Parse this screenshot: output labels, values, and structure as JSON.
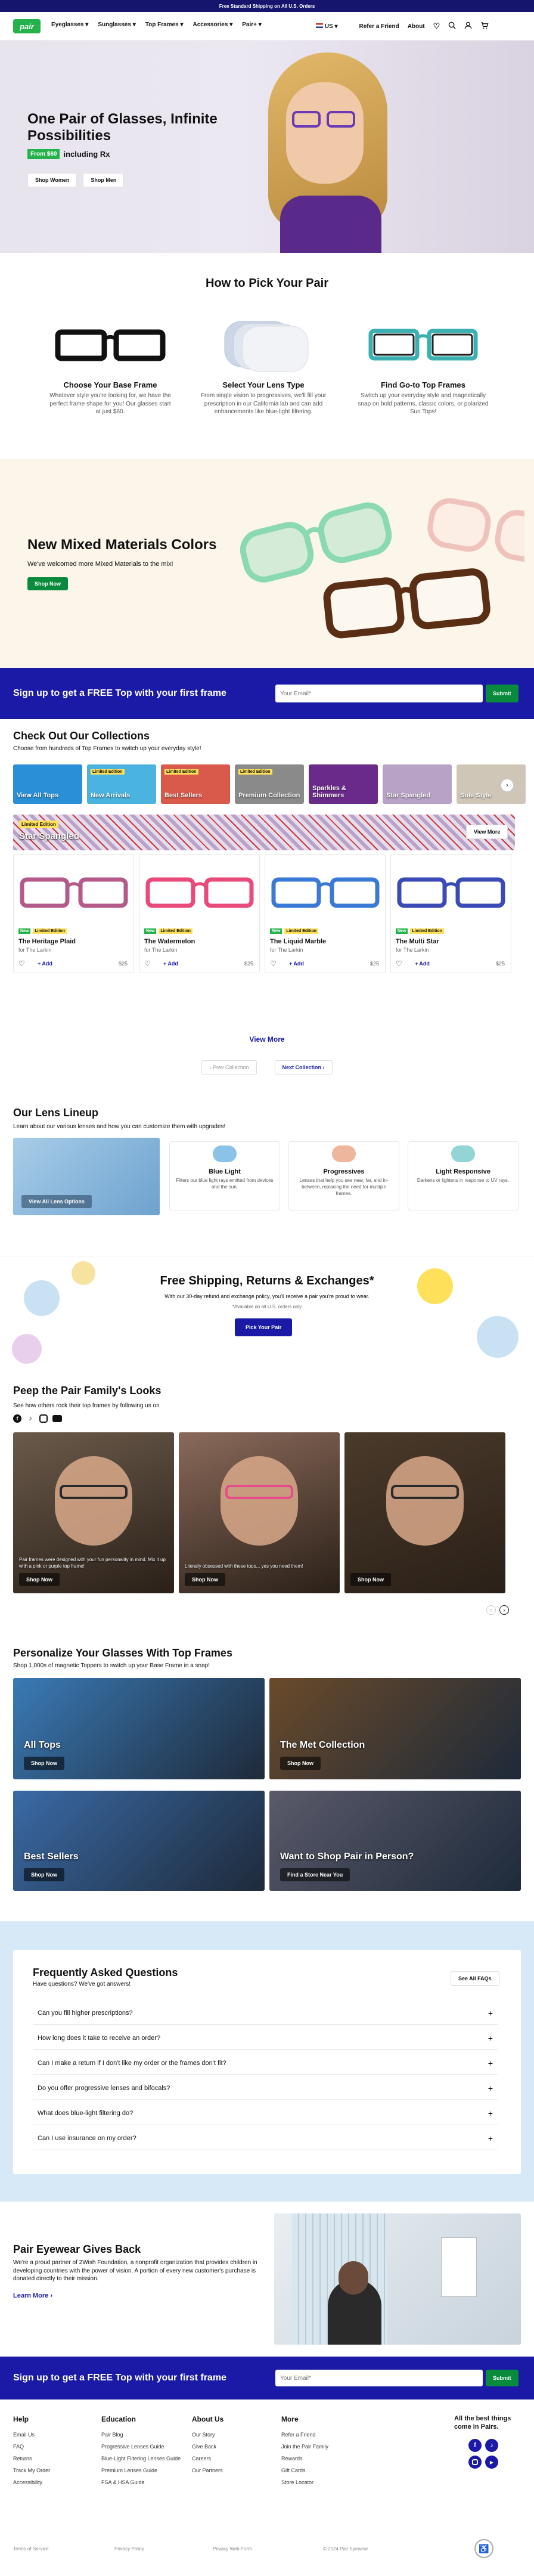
{
  "promo_bar": {
    "text": "Free Standard Shipping on All U.S. Orders"
  },
  "header": {
    "logo": "pair",
    "nav": [
      "Eyeglasses",
      "Sunglasses",
      "Top Frames",
      "Accessories",
      "Pair+"
    ],
    "region": "US",
    "refer": "Refer a Friend",
    "about": "About"
  },
  "hero": {
    "title": "One Pair of Glasses, Infinite Possibilities",
    "price_badge": "From $60",
    "price_suffix": "including Rx",
    "btn_women": "Shop Women",
    "btn_men": "Shop Men"
  },
  "how_to": {
    "title": "How to Pick Your Pair",
    "steps": [
      {
        "title": "Choose Your Base Frame",
        "text": "Whatever style you're looking for, we have the perfect frame shape for you! Our glasses start at just $60."
      },
      {
        "title": "Select Your Lens Type",
        "text": "From single vision to progressives, we'll fill your prescription in our California lab and can add enhancements like blue-light filtering."
      },
      {
        "title": "Find Go-to Top Frames",
        "text": "Switch up your everyday style and magnetically snap on bold patterns, classic colors, or polarized Sun Tops!"
      }
    ]
  },
  "mixed": {
    "title": "New Mixed Materials Colors",
    "text": "We've welcomed more Mixed Materials to the mix!",
    "btn": "Shop Now"
  },
  "signup": {
    "title": "Sign up to get a FREE Top with your first frame",
    "placeholder": "Your Email*",
    "btn": "Submit"
  },
  "collections": {
    "title": "Check Out Our Collections",
    "subtitle": "Choose from hundreds of Top Frames to switch up your everyday style!",
    "tiles": [
      {
        "label": "View All Tops",
        "badge": "",
        "color": "#2a8fd6"
      },
      {
        "label": "New Arrivals",
        "badge": "Limited Edition",
        "color": "#4ab3e0"
      },
      {
        "label": "Best Sellers",
        "badge": "Limited Edition",
        "color": "#d95a4a"
      },
      {
        "label": "Premium Collection",
        "badge": "Limited Edition",
        "color": "#8a8a8a"
      },
      {
        "label": "Sparkles & Shimmers",
        "badge": "",
        "color": "#6a2a8a"
      },
      {
        "label": "Star Spangled",
        "badge": "",
        "color": "#b8a2c6"
      },
      {
        "label": "Sole Style",
        "badge": "",
        "color": "#d0c6b8"
      }
    ],
    "feature_badge": "Limited Edition",
    "feature_title": "Star Spangled",
    "feature_btn": "View More",
    "products": [
      {
        "name": "The Heritage Plaid",
        "sub": "for The Larkin",
        "price": "$25",
        "tag_new": "New",
        "tag_ltd": "Limited Edition",
        "frame": "#b45a8a"
      },
      {
        "name": "The Watermelon",
        "sub": "for The Larkin",
        "price": "$25",
        "tag_new": "New",
        "tag_ltd": "Limited Edition",
        "frame": "#e94a7a"
      },
      {
        "name": "The Liquid Marble",
        "sub": "for The Larkin",
        "price": "$25",
        "tag_new": "New",
        "tag_ltd": "Limited Edition",
        "frame": "#3a7ad6"
      },
      {
        "name": "The Multi Star",
        "sub": "for The Larkin",
        "price": "$25",
        "tag_new": "New",
        "tag_ltd": "Limited Edition",
        "frame": "#3a4ab6"
      }
    ],
    "add_label": "+ Add",
    "view_more": "View More",
    "prev": "Prev Collection",
    "next": "Next Collection"
  },
  "lens": {
    "title": "Our Lens Lineup",
    "subtitle": "Learn about our various lenses and how you can customize them with upgrades!",
    "btn": "View All Lens Options",
    "items": [
      {
        "title": "Blue Light",
        "text": "Filters our blue light rays emitted from devices and the sun."
      },
      {
        "title": "Progressives",
        "text": "Lenses that help you see near, far, and in-between, replacing the need for multiple frames."
      },
      {
        "title": "Light Responsive",
        "text": "Darkens or lightens in response to UV rays."
      }
    ]
  },
  "shipping": {
    "title": "Free Shipping, Returns & Exchanges*",
    "text": "With our 30-day refund and exchange policy, you'll receive a pair you're proud to wear.",
    "note": "*Available on all U.S. orders only",
    "btn": "Pick Your Pair"
  },
  "family": {
    "title": "Peep the Pair Family's Looks",
    "subtitle": "See how others rock their top frames by following us on",
    "cards": [
      {
        "caption": "Pair frames were designed with your fun personality in mind. Mix it up with a pink or purple top frame!",
        "btn": "Shop Now",
        "bg": "#6a5a4a"
      },
      {
        "caption": "Literally obsessed with these tops... yes you need them!",
        "btn": "Shop Now",
        "bg": "#8a6a5a"
      },
      {
        "caption": "",
        "btn": "Shop Now",
        "bg": "#4a3a2a"
      }
    ]
  },
  "personalize": {
    "title": "Personalize Your Glasses With Top Frames",
    "subtitle": "Shop 1,000s of magnetic Toppers to switch up your Base Frame in a snap!",
    "tiles": [
      {
        "title": "All Tops",
        "btn": "Shop Now",
        "bg": "#3a7ab6"
      },
      {
        "title": "The Met Collection",
        "btn": "Shop Now",
        "bg": "#6a4a2a"
      },
      {
        "title": "Best Sellers",
        "btn": "Shop Now",
        "bg": "#3a6aa6"
      },
      {
        "title": "Want to Shop Pair in Person?",
        "btn": "Find a Store Near You",
        "bg": "#5a5a6a"
      }
    ]
  },
  "faq": {
    "title": "Frequently Asked Questions",
    "subtitle": "Have questions? We've got answers!",
    "see_all": "See All FAQs",
    "items": [
      "Can you fill higher prescriptions?",
      "How long does it take to receive an order?",
      "Can I make a return if I don't like my order or the frames don't fit?",
      "Do you offer progressive lenses and bifocals?",
      "What does blue-light filtering do?",
      "Can I use insurance on my order?"
    ]
  },
  "giveback": {
    "title": "Pair Eyewear Gives Back",
    "text": "We're a proud partner of 2Wish Foundation, a nonprofit organization that provides children in developing countries with the power of vision. A portion of every new customer's purchase is donated directly to their mission.",
    "btn": "Learn More"
  },
  "footer": {
    "cols": [
      {
        "title": "Help",
        "links": [
          "Email Us",
          "FAQ",
          "Returns",
          "Track My Order",
          "Accessibility"
        ]
      },
      {
        "title": "Education",
        "links": [
          "Pair Blog",
          "Progressive Lenses Guide",
          "Blue-Light Filtering Lenses Guide",
          "Premium Lenses Guide",
          "FSA & HSA Guide"
        ]
      },
      {
        "title": "About Us",
        "links": [
          "Our Story",
          "Give Back",
          "Careers",
          "Our Partners"
        ]
      },
      {
        "title": "More",
        "links": [
          "Refer a Friend",
          "Join the Pair Family",
          "Rewards",
          "Gift Cards",
          "Store Locator"
        ]
      }
    ],
    "social_title": "All the best things come in Pairs.",
    "bottom": [
      "Terms of Service",
      "Privacy Policy",
      "Privacy Web Form",
      "© 2024 Pair Eyewear"
    ]
  }
}
